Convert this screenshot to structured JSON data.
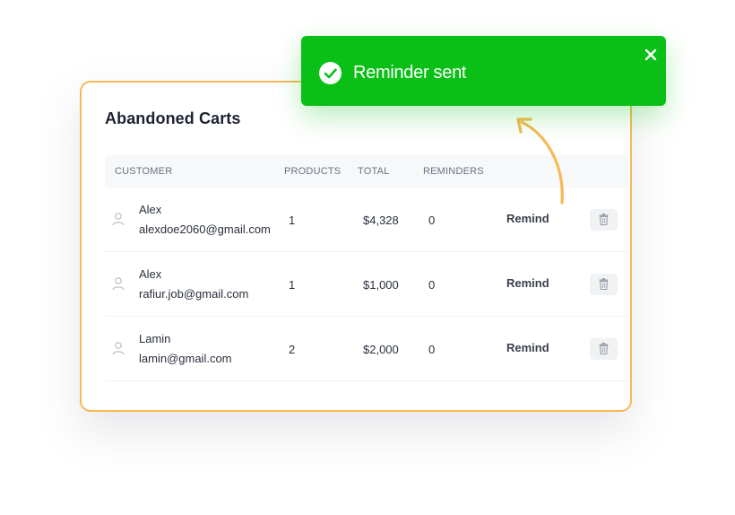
{
  "card": {
    "title": "Abandoned Carts",
    "columns": {
      "customer": "CUSTOMER",
      "products": "PRODUCTS",
      "total": "TOTAL",
      "reminders": "REMINDERS"
    },
    "rows": [
      {
        "name": "Alex",
        "email": "alexdoe2060@gmail.com",
        "products": "1",
        "total": "$4,328",
        "reminders": "0",
        "action": "Remind"
      },
      {
        "name": "Alex",
        "email": "rafiur.job@gmail.com",
        "products": "1",
        "total": "$1,000",
        "reminders": "0",
        "action": "Remind"
      },
      {
        "name": "Lamin",
        "email": "lamin@gmail.com",
        "products": "2",
        "total": "$2,000",
        "reminders": "0",
        "action": "Remind"
      }
    ]
  },
  "toast": {
    "message": "Reminder sent",
    "color": "#0ac016"
  },
  "colors": {
    "card_border": "#f6b955",
    "arrow": "#f6b955"
  }
}
